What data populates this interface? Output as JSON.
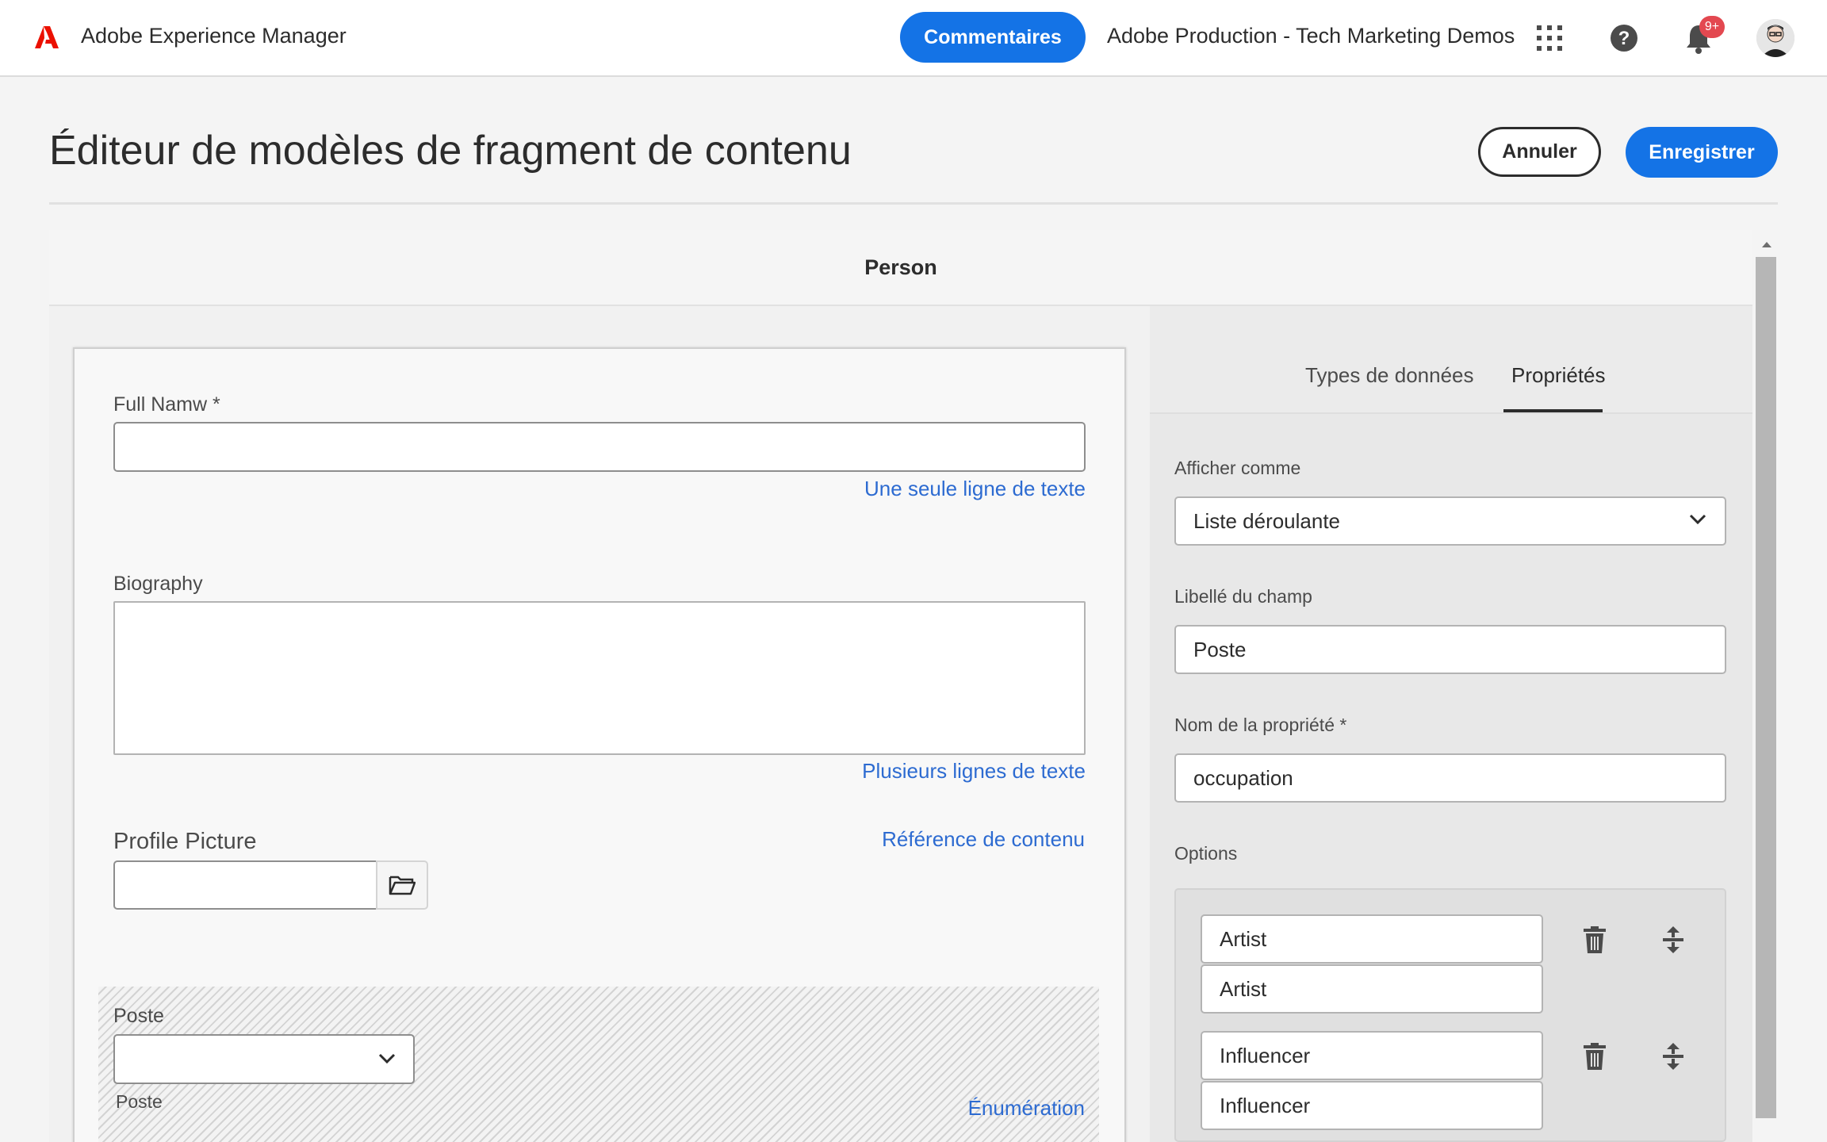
{
  "shell": {
    "app_title": "Adobe Experience Manager",
    "feedback_label": "Commentaires",
    "org_name": "Adobe Production - Tech Marketing Demos",
    "notification_badge": "9+",
    "brand_color": "#eb1000",
    "accent_color": "#1473e6",
    "icons": [
      "adobe-logo",
      "apps-grid-icon",
      "help-icon",
      "bell-icon",
      "avatar"
    ]
  },
  "header": {
    "title": "Éditeur de modèles de fragment de contenu",
    "cancel_label": "Annuler",
    "save_label": "Enregistrer"
  },
  "model": {
    "name": "Person"
  },
  "fields": [
    {
      "label": "Full Namw *",
      "type": "Une seule ligne de texte",
      "value": ""
    },
    {
      "label": "Biography",
      "type": "Plusieurs lignes de texte",
      "value": ""
    },
    {
      "label": "Profile Picture",
      "type": "Référence de contenu",
      "value": ""
    },
    {
      "label": "Poste",
      "type": "Énumération",
      "value": "",
      "sublabel": "Poste"
    }
  ],
  "panel": {
    "tabs": [
      {
        "label": "Types de données",
        "active": false
      },
      {
        "label": "Propriétés",
        "active": true
      }
    ],
    "render_as": {
      "label": "Afficher comme",
      "value": "Liste déroulante"
    },
    "field_label": {
      "label": "Libellé du champ",
      "value": "Poste"
    },
    "property_name": {
      "label": "Nom de la propriété *",
      "value": "occupation"
    },
    "options_label": "Options",
    "options": [
      {
        "text": "Artist",
        "value": "Artist"
      },
      {
        "text": "Influencer",
        "value": "Influencer"
      }
    ]
  }
}
